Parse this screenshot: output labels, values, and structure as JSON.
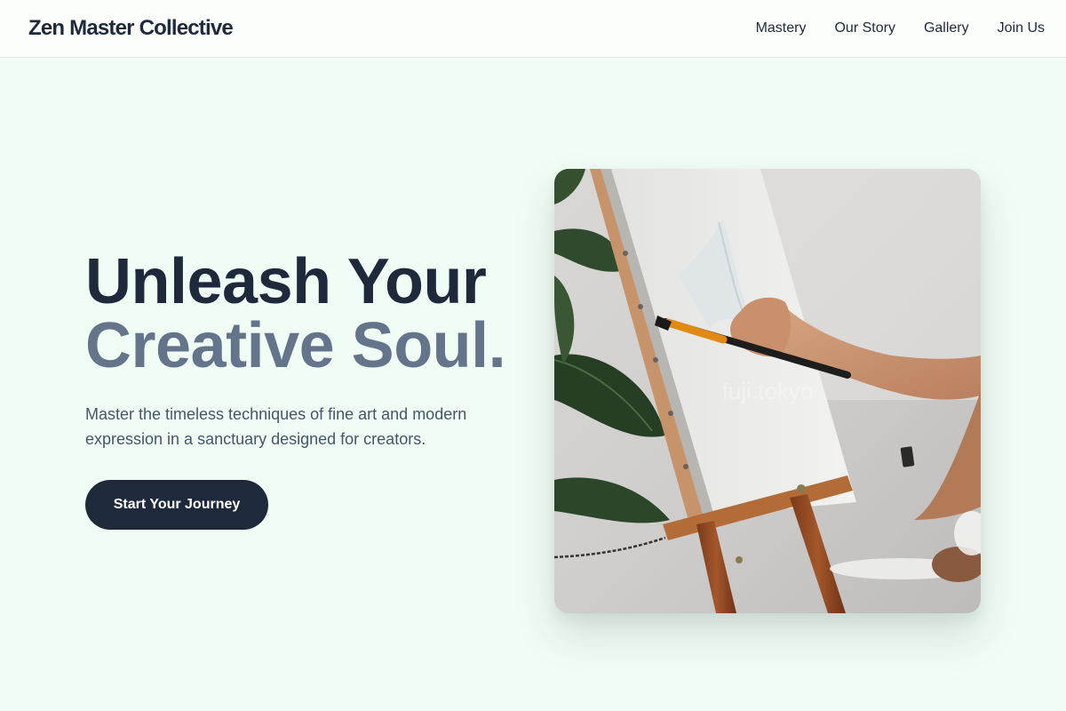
{
  "brand": {
    "name": "Zen Master Collective"
  },
  "nav": {
    "links": [
      {
        "label": "Mastery"
      },
      {
        "label": "Our Story"
      },
      {
        "label": "Gallery"
      },
      {
        "label": "Join Us"
      }
    ]
  },
  "hero": {
    "title_line1": "Unleash Your",
    "title_line2": "Creative Soul.",
    "subtitle": "Master the timeless techniques of fine art and modern expression in a sanctuary designed for creators.",
    "cta_label": "Start Your Journey",
    "image": {
      "subject": "painting-at-easel-photo",
      "watermark": "fuji.tokyo"
    }
  },
  "colors": {
    "background": "#f0fdf4",
    "primary": "#1e293b",
    "accent_text": "#64748b",
    "body_text": "#475569"
  }
}
